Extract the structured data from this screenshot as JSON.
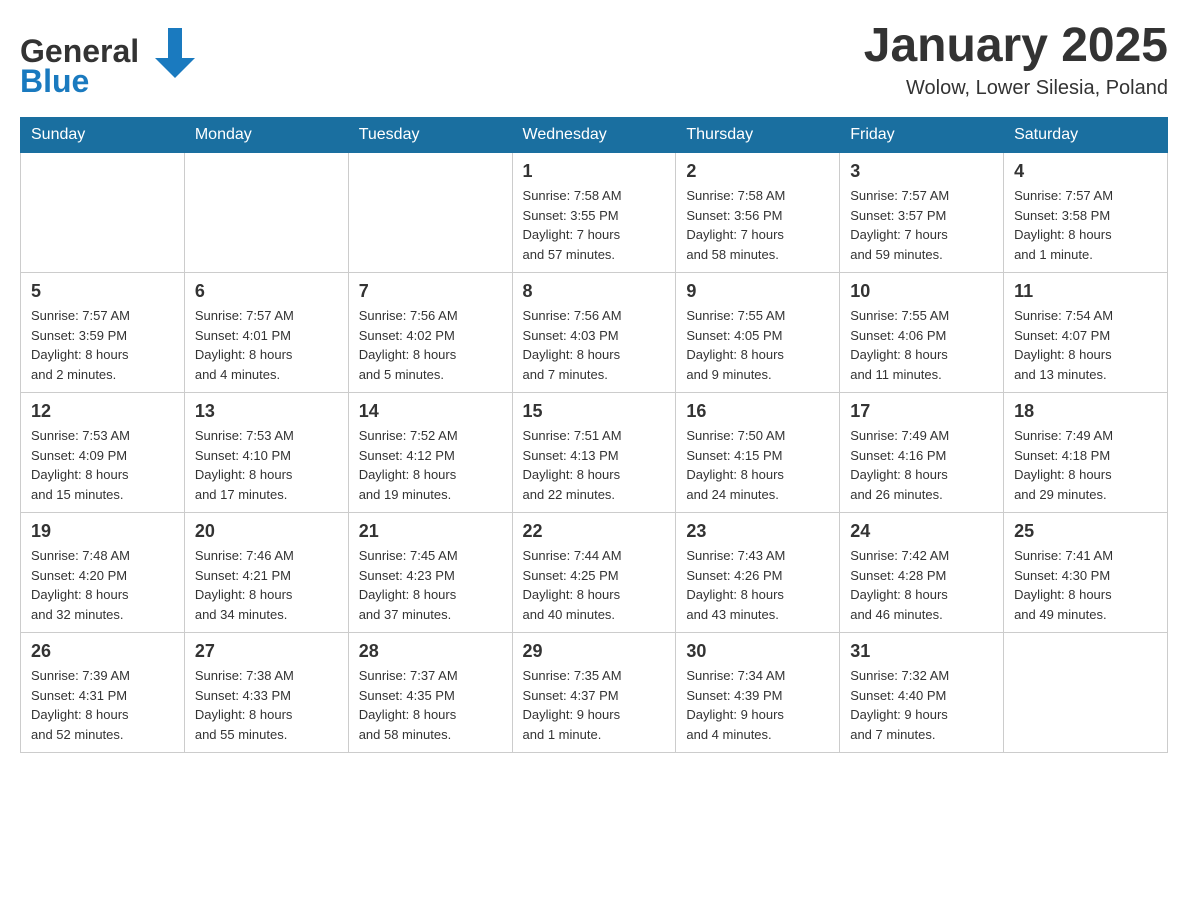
{
  "header": {
    "logo": {
      "general": "General",
      "blue": "Blue"
    },
    "title": "January 2025",
    "location": "Wolow, Lower Silesia, Poland"
  },
  "days_of_week": [
    "Sunday",
    "Monday",
    "Tuesday",
    "Wednesday",
    "Thursday",
    "Friday",
    "Saturday"
  ],
  "weeks": [
    [
      {
        "day": "",
        "info": ""
      },
      {
        "day": "",
        "info": ""
      },
      {
        "day": "",
        "info": ""
      },
      {
        "day": "1",
        "info": "Sunrise: 7:58 AM\nSunset: 3:55 PM\nDaylight: 7 hours\nand 57 minutes."
      },
      {
        "day": "2",
        "info": "Sunrise: 7:58 AM\nSunset: 3:56 PM\nDaylight: 7 hours\nand 58 minutes."
      },
      {
        "day": "3",
        "info": "Sunrise: 7:57 AM\nSunset: 3:57 PM\nDaylight: 7 hours\nand 59 minutes."
      },
      {
        "day": "4",
        "info": "Sunrise: 7:57 AM\nSunset: 3:58 PM\nDaylight: 8 hours\nand 1 minute."
      }
    ],
    [
      {
        "day": "5",
        "info": "Sunrise: 7:57 AM\nSunset: 3:59 PM\nDaylight: 8 hours\nand 2 minutes."
      },
      {
        "day": "6",
        "info": "Sunrise: 7:57 AM\nSunset: 4:01 PM\nDaylight: 8 hours\nand 4 minutes."
      },
      {
        "day": "7",
        "info": "Sunrise: 7:56 AM\nSunset: 4:02 PM\nDaylight: 8 hours\nand 5 minutes."
      },
      {
        "day": "8",
        "info": "Sunrise: 7:56 AM\nSunset: 4:03 PM\nDaylight: 8 hours\nand 7 minutes."
      },
      {
        "day": "9",
        "info": "Sunrise: 7:55 AM\nSunset: 4:05 PM\nDaylight: 8 hours\nand 9 minutes."
      },
      {
        "day": "10",
        "info": "Sunrise: 7:55 AM\nSunset: 4:06 PM\nDaylight: 8 hours\nand 11 minutes."
      },
      {
        "day": "11",
        "info": "Sunrise: 7:54 AM\nSunset: 4:07 PM\nDaylight: 8 hours\nand 13 minutes."
      }
    ],
    [
      {
        "day": "12",
        "info": "Sunrise: 7:53 AM\nSunset: 4:09 PM\nDaylight: 8 hours\nand 15 minutes."
      },
      {
        "day": "13",
        "info": "Sunrise: 7:53 AM\nSunset: 4:10 PM\nDaylight: 8 hours\nand 17 minutes."
      },
      {
        "day": "14",
        "info": "Sunrise: 7:52 AM\nSunset: 4:12 PM\nDaylight: 8 hours\nand 19 minutes."
      },
      {
        "day": "15",
        "info": "Sunrise: 7:51 AM\nSunset: 4:13 PM\nDaylight: 8 hours\nand 22 minutes."
      },
      {
        "day": "16",
        "info": "Sunrise: 7:50 AM\nSunset: 4:15 PM\nDaylight: 8 hours\nand 24 minutes."
      },
      {
        "day": "17",
        "info": "Sunrise: 7:49 AM\nSunset: 4:16 PM\nDaylight: 8 hours\nand 26 minutes."
      },
      {
        "day": "18",
        "info": "Sunrise: 7:49 AM\nSunset: 4:18 PM\nDaylight: 8 hours\nand 29 minutes."
      }
    ],
    [
      {
        "day": "19",
        "info": "Sunrise: 7:48 AM\nSunset: 4:20 PM\nDaylight: 8 hours\nand 32 minutes."
      },
      {
        "day": "20",
        "info": "Sunrise: 7:46 AM\nSunset: 4:21 PM\nDaylight: 8 hours\nand 34 minutes."
      },
      {
        "day": "21",
        "info": "Sunrise: 7:45 AM\nSunset: 4:23 PM\nDaylight: 8 hours\nand 37 minutes."
      },
      {
        "day": "22",
        "info": "Sunrise: 7:44 AM\nSunset: 4:25 PM\nDaylight: 8 hours\nand 40 minutes."
      },
      {
        "day": "23",
        "info": "Sunrise: 7:43 AM\nSunset: 4:26 PM\nDaylight: 8 hours\nand 43 minutes."
      },
      {
        "day": "24",
        "info": "Sunrise: 7:42 AM\nSunset: 4:28 PM\nDaylight: 8 hours\nand 46 minutes."
      },
      {
        "day": "25",
        "info": "Sunrise: 7:41 AM\nSunset: 4:30 PM\nDaylight: 8 hours\nand 49 minutes."
      }
    ],
    [
      {
        "day": "26",
        "info": "Sunrise: 7:39 AM\nSunset: 4:31 PM\nDaylight: 8 hours\nand 52 minutes."
      },
      {
        "day": "27",
        "info": "Sunrise: 7:38 AM\nSunset: 4:33 PM\nDaylight: 8 hours\nand 55 minutes."
      },
      {
        "day": "28",
        "info": "Sunrise: 7:37 AM\nSunset: 4:35 PM\nDaylight: 8 hours\nand 58 minutes."
      },
      {
        "day": "29",
        "info": "Sunrise: 7:35 AM\nSunset: 4:37 PM\nDaylight: 9 hours\nand 1 minute."
      },
      {
        "day": "30",
        "info": "Sunrise: 7:34 AM\nSunset: 4:39 PM\nDaylight: 9 hours\nand 4 minutes."
      },
      {
        "day": "31",
        "info": "Sunrise: 7:32 AM\nSunset: 4:40 PM\nDaylight: 9 hours\nand 7 minutes."
      },
      {
        "day": "",
        "info": ""
      }
    ]
  ],
  "colors": {
    "header_bg": "#1a6fa0",
    "header_text": "#ffffff",
    "border": "#cccccc",
    "text": "#333333",
    "logo_blue": "#1a7abf"
  }
}
